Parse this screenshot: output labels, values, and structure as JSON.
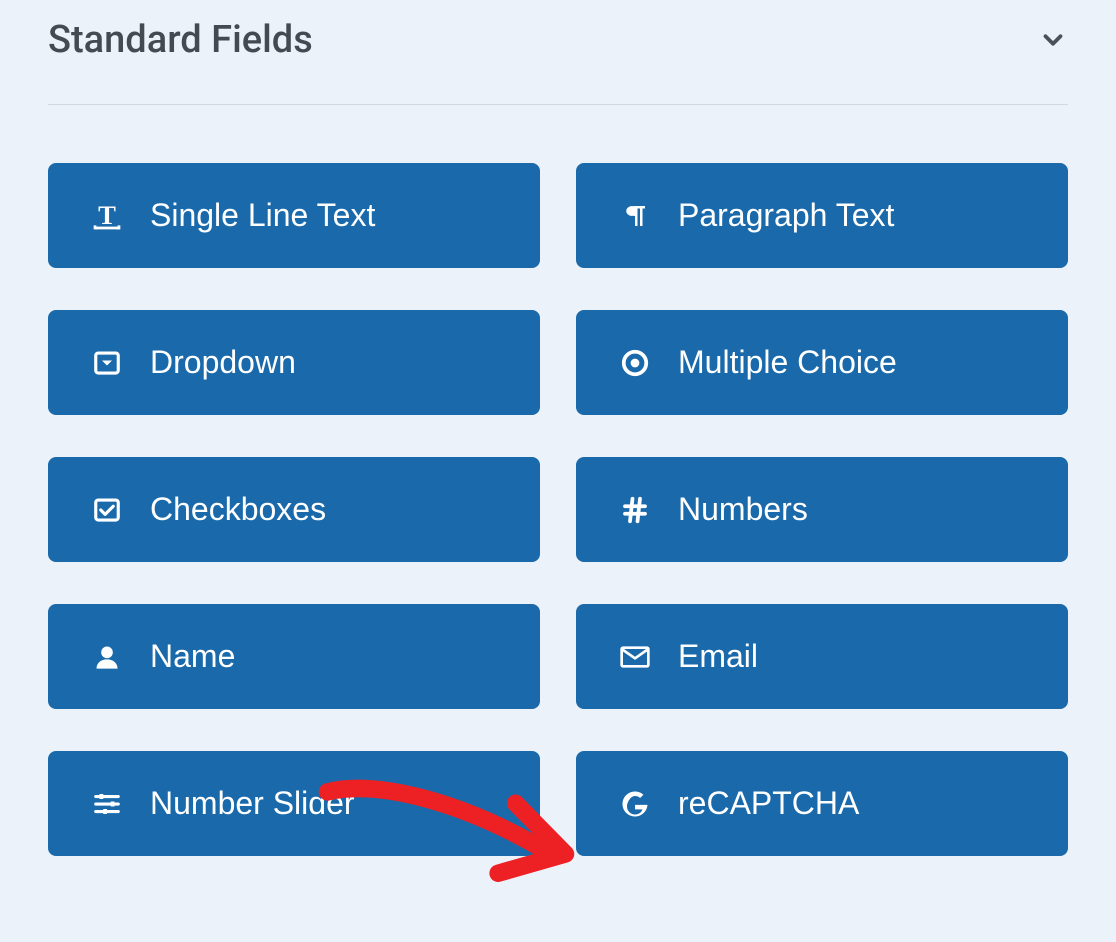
{
  "section": {
    "title": "Standard Fields"
  },
  "fields": [
    {
      "icon": "text-cursor-icon",
      "label": "Single Line Text"
    },
    {
      "icon": "paragraph-icon",
      "label": "Paragraph Text"
    },
    {
      "icon": "dropdown-icon",
      "label": "Dropdown"
    },
    {
      "icon": "radio-icon",
      "label": "Multiple Choice"
    },
    {
      "icon": "checkbox-icon",
      "label": "Checkboxes"
    },
    {
      "icon": "hash-icon",
      "label": "Numbers"
    },
    {
      "icon": "user-icon",
      "label": "Name"
    },
    {
      "icon": "envelope-icon",
      "label": "Email"
    },
    {
      "icon": "sliders-icon",
      "label": "Number Slider"
    },
    {
      "icon": "google-icon",
      "label": "reCAPTCHA"
    }
  ],
  "colors": {
    "button_bg": "#1a6aab",
    "button_text": "#ffffff",
    "page_bg": "#ecf2f9",
    "title_text": "#444a52",
    "arrow": "#ed2024"
  }
}
